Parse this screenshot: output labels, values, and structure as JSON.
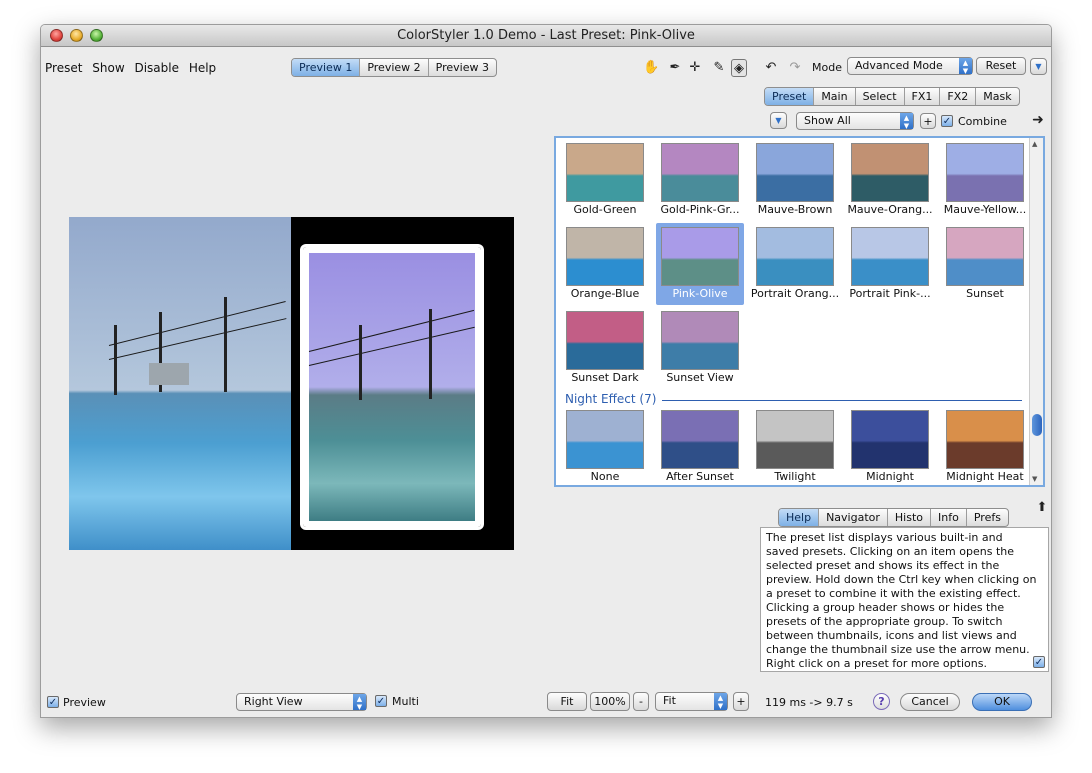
{
  "window": {
    "title": "ColorStyler 1.0 Demo - Last Preset: Pink-Olive"
  },
  "menu": [
    "Preset",
    "Show",
    "Disable",
    "Help"
  ],
  "preview_tabs": [
    {
      "label": "Preview 1",
      "active": true
    },
    {
      "label": "Preview 2",
      "active": false
    },
    {
      "label": "Preview 3",
      "active": false
    }
  ],
  "tools": {
    "hand": "✋",
    "eyedropper": "✒",
    "crosshair": "✛",
    "brush": "✎",
    "split": "◈",
    "undo": "↶",
    "redo": "↷"
  },
  "mode": {
    "label": "Mode",
    "value": "Advanced Mode",
    "reset": "Reset"
  },
  "panel_tabs": [
    {
      "label": "Preset",
      "active": true
    },
    {
      "label": "Main"
    },
    {
      "label": "Select"
    },
    {
      "label": "FX1"
    },
    {
      "label": "FX2"
    },
    {
      "label": "Mask"
    }
  ],
  "filter": {
    "value": "Show All",
    "plus": "+",
    "combine_label": "Combine",
    "combine_checked": true
  },
  "presets": [
    {
      "name": "Gold-Green",
      "c1": "#c9a88a",
      "c2": "#3f9aa0"
    },
    {
      "name": "Gold-Pink-Gr...",
      "c1": "#b487c1",
      "c2": "#4a8c9a"
    },
    {
      "name": "Mauve-Brown",
      "c1": "#8aa6db",
      "c2": "#3b6ea3"
    },
    {
      "name": "Mauve-Orang...",
      "c1": "#c19173",
      "c2": "#2e5c66"
    },
    {
      "name": "Mauve-Yellow...",
      "c1": "#9eaee5",
      "c2": "#7a71b0"
    },
    {
      "name": "Orange-Blue",
      "c1": "#c0b5a8",
      "c2": "#2c8ed0"
    },
    {
      "name": "Pink-Olive",
      "c1": "#a99be8",
      "c2": "#5d8f87"
    },
    {
      "name": "Portrait Orang...",
      "c1": "#a3bce0",
      "c2": "#3a8fc0"
    },
    {
      "name": "Portrait Pink-...",
      "c1": "#b8c7e6",
      "c2": "#3a8fc8"
    },
    {
      "name": "Sunset",
      "c1": "#d6a6c0",
      "c2": "#4f8ec8"
    },
    {
      "name": "Sunset Dark",
      "c1": "#c25e86",
      "c2": "#2a6b9a"
    },
    {
      "name": "Sunset View",
      "c1": "#b08ab8",
      "c2": "#3e7da8"
    }
  ],
  "selected_preset": "Pink-Olive",
  "night_group": {
    "title": "Night Effect (7)",
    "presets": [
      {
        "name": "None",
        "c1": "#9eb1d2",
        "c2": "#3b93d2"
      },
      {
        "name": "After Sunset",
        "c1": "#7a6fb4",
        "c2": "#2f4f88"
      },
      {
        "name": "Twilight",
        "c1": "#c4c4c4",
        "c2": "#5a5a5a"
      },
      {
        "name": "Midnight",
        "c1": "#3c4f9c",
        "c2": "#22336e"
      },
      {
        "name": "Midnight Heat",
        "c1": "#d98f4a",
        "c2": "#6b3b2b"
      }
    ]
  },
  "info_tabs": [
    {
      "label": "Help",
      "active": true
    },
    {
      "label": "Navigator"
    },
    {
      "label": "Histo"
    },
    {
      "label": "Info"
    },
    {
      "label": "Prefs"
    }
  ],
  "help_text": "The preset list displays various built-in and saved presets. Clicking on an item opens the selected preset and shows its effect in the preview. Hold down the Ctrl key when clicking on a preset to combine it with the existing effect. Clicking a group header shows or hides the presets of the appropriate group. To switch between thumbnails, icons and list views and change the thumbnail size use the arrow menu. Right click on a preset for more options.",
  "bottom": {
    "preview_label": "Preview",
    "view_value": "Right View",
    "multi_label": "Multi",
    "fit_label": "Fit",
    "zoom_value": "100%",
    "minus": "-",
    "fit_select": "Fit",
    "plus": "+",
    "timing": "119 ms -> 9.7 s",
    "help_icon": "?",
    "cancel": "Cancel",
    "ok": "OK"
  },
  "colors": {
    "accent": "#2f70c8",
    "selection": "#7fa7e6",
    "group_header": "#2e5fb0"
  }
}
